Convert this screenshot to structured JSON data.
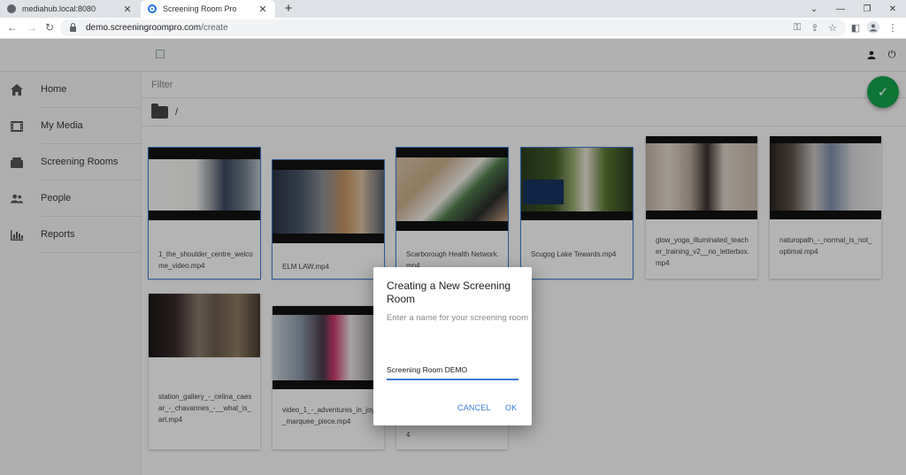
{
  "browser": {
    "tabs": [
      {
        "title": "mediahub.local:8080",
        "active": false
      },
      {
        "title": "Screening Room Pro",
        "active": true
      }
    ],
    "new_tab": "+",
    "url_host": "demo.screeningroompro.com",
    "url_path": "/create",
    "icons": [
      "back-icon",
      "forward-icon",
      "reload-icon",
      "lock-icon",
      "key-icon",
      "share-icon",
      "star-icon",
      "sidepanel-icon",
      "profile-icon",
      "menu-icon"
    ]
  },
  "header": {
    "icons": [
      "user-icon",
      "power-icon"
    ]
  },
  "sidebar": {
    "items": [
      {
        "label": "Home",
        "icon": "home-icon"
      },
      {
        "label": "My Media",
        "icon": "film-icon"
      },
      {
        "label": "Screening Rooms",
        "icon": "screen-icon"
      },
      {
        "label": "People",
        "icon": "people-icon"
      },
      {
        "label": "Reports",
        "icon": "chart-icon"
      }
    ]
  },
  "filter": {
    "placeholder": "Filter"
  },
  "path": {
    "text": "/"
  },
  "media": [
    {
      "name": "1_the_shoulder_centre_welcome_video.mp4",
      "selected": true
    },
    {
      "name": "ELM LAW.mp4",
      "selected": true
    },
    {
      "name": "Scarborough Health Network.mp4",
      "selected": true
    },
    {
      "name": "Scugog Lake Tewards.mp4",
      "selected": true
    },
    {
      "name": "glow_yoga_illuminated_teacher_training_v2__no_letterbox.mp4",
      "selected": false
    },
    {
      "name": "naturopath_-_normal_is_not_optimal.mp4",
      "selected": false
    },
    {
      "name": "station_gallery_-_celina_caesar_-_chavannes_-__what_is_art.mp4",
      "selected": false
    },
    {
      "name": "video_1_-_adventures_in_joy_marquee_piece.mp4",
      "selected": false
    },
    {
      "name": "4",
      "selected": false
    }
  ],
  "dialog": {
    "title": "Creating a New Screening Room",
    "text": "Enter a name for your screening room",
    "input_value": "Screening Room DEMO",
    "cancel_label": "CANCEL",
    "ok_label": "OK"
  },
  "colors": {
    "accent": "#3a7bd5",
    "fab": "#16a34a"
  }
}
